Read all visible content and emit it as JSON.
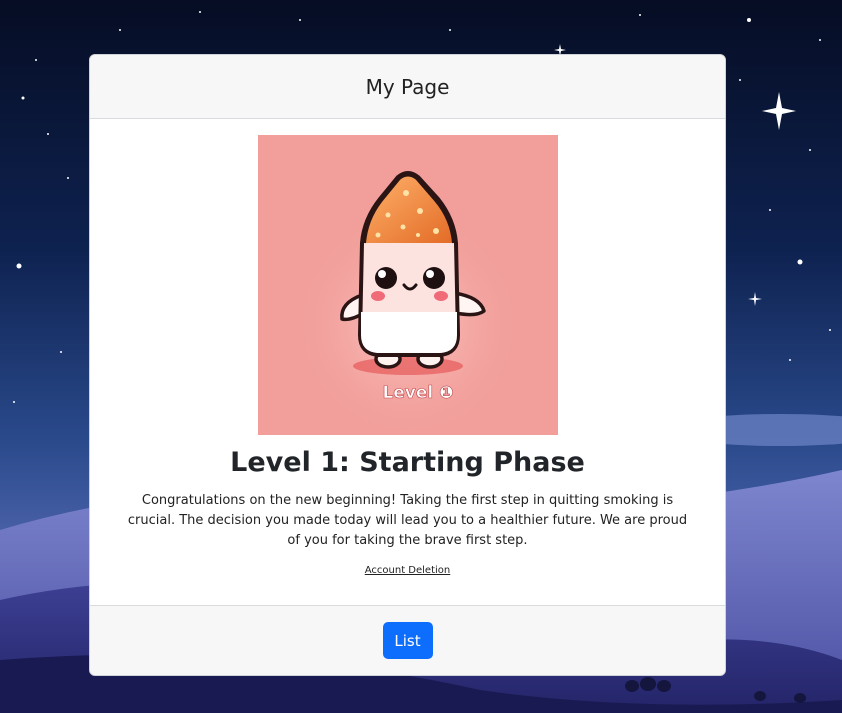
{
  "header": {
    "title": "My Page"
  },
  "mascot": {
    "badge_text": "Level ❶",
    "badge_number": "1"
  },
  "level": {
    "title": "Level 1: Starting Phase",
    "description": "Congratulations on the new beginning! Taking the first step in quitting smoking is crucial. The decision you made today will lead you to a healthier future. We are proud of you for taking the brave first step."
  },
  "links": {
    "account_deletion": "Account Deletion"
  },
  "footer": {
    "list_label": "List"
  },
  "colors": {
    "primary": "#0d6efd",
    "image_bg": "#f29f9b",
    "night_sky": "#0b1633"
  }
}
